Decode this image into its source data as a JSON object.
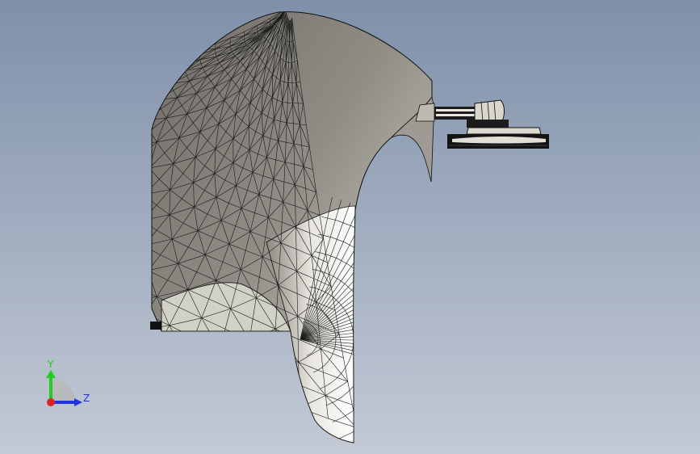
{
  "viewport": {
    "background_top": "#7f90aa",
    "background_bottom": "#c3cad5",
    "model": {
      "description_icon": "meshed-3d-model",
      "shade_dark": "#7c7a72",
      "shade_mid": "#a8a69d",
      "shade_light": "#ffffff",
      "edge_color": "#111111"
    }
  },
  "triad": {
    "y_label": "Y",
    "z_label": "Z",
    "y_color": "#22cc22",
    "z_color": "#2233dd",
    "x_color": "#dd2222"
  }
}
